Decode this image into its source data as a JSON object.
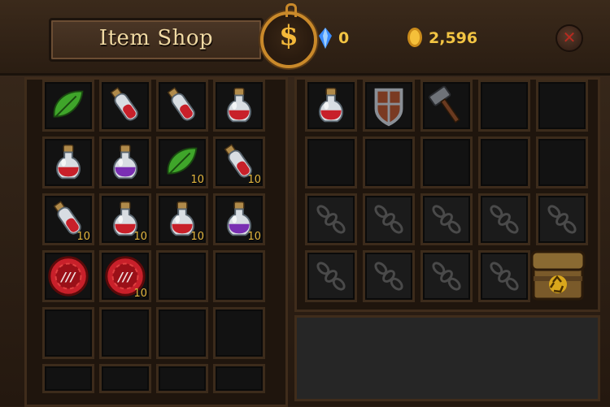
{
  "header": {
    "title": "Item Shop",
    "crystal_count": "0",
    "gold_count": "2,596",
    "shop_icon": "dollar-coin-icon",
    "close_icon": "close-x-icon"
  },
  "shop_grid": [
    {
      "item": "green-leaf",
      "qty": ""
    },
    {
      "item": "red-vial",
      "qty": ""
    },
    {
      "item": "red-vial",
      "qty": ""
    },
    {
      "item": "red-potion-flask",
      "qty": ""
    },
    {
      "item": "red-potion-flask",
      "qty": ""
    },
    {
      "item": "purple-potion-flask",
      "qty": ""
    },
    {
      "item": "green-leaf",
      "qty": "10"
    },
    {
      "item": "red-vial",
      "qty": "10"
    },
    {
      "item": "red-vial",
      "qty": "10"
    },
    {
      "item": "red-potion-flask",
      "qty": "10"
    },
    {
      "item": "red-potion-flask",
      "qty": "10"
    },
    {
      "item": "purple-potion-flask",
      "qty": "10"
    },
    {
      "item": "red-chip",
      "qty": ""
    },
    {
      "item": "red-chip",
      "qty": "10"
    },
    {
      "item": "",
      "qty": ""
    },
    {
      "item": "",
      "qty": ""
    },
    {
      "item": "",
      "qty": ""
    },
    {
      "item": "",
      "qty": ""
    },
    {
      "item": "",
      "qty": ""
    },
    {
      "item": "",
      "qty": ""
    },
    {
      "item": "",
      "qty": ""
    },
    {
      "item": "",
      "qty": ""
    },
    {
      "item": "",
      "qty": ""
    },
    {
      "item": "",
      "qty": ""
    }
  ],
  "inventory_grid": [
    {
      "item": "red-potion-flask",
      "locked": false
    },
    {
      "item": "wooden-shield",
      "locked": false
    },
    {
      "item": "iron-hammer",
      "locked": false
    },
    {
      "item": "",
      "locked": false
    },
    {
      "item": "",
      "locked": false
    },
    {
      "item": "",
      "locked": false
    },
    {
      "item": "",
      "locked": false
    },
    {
      "item": "",
      "locked": false
    },
    {
      "item": "",
      "locked": false
    },
    {
      "item": "",
      "locked": false
    },
    {
      "item": "",
      "locked": true
    },
    {
      "item": "",
      "locked": true
    },
    {
      "item": "",
      "locked": true
    },
    {
      "item": "",
      "locked": true
    },
    {
      "item": "",
      "locked": true
    },
    {
      "item": "",
      "locked": true
    },
    {
      "item": "",
      "locked": true
    },
    {
      "item": "",
      "locked": true
    },
    {
      "item": "",
      "locked": true
    }
  ],
  "recycle": {
    "icon": "recycle-chest-icon"
  },
  "colors": {
    "gold_text": "#f2c443",
    "title_text": "#f0d9a3",
    "red_potion": "#c8202a",
    "purple_potion": "#7a2fb3",
    "leaf": "#3fa52a"
  }
}
